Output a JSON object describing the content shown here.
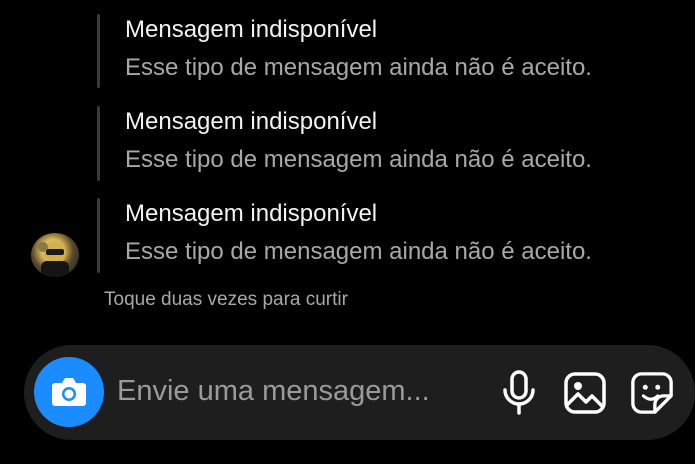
{
  "messages": [
    {
      "title": "Mensagem indisponível",
      "subtitle": "Esse tipo de mensagem ainda não é aceito."
    },
    {
      "title": "Mensagem indisponível",
      "subtitle": "Esse tipo de mensagem ainda não é aceito."
    },
    {
      "title": "Mensagem indisponível",
      "subtitle": "Esse tipo de mensagem ainda não é aceito."
    }
  ],
  "hint": "Toque duas vezes para curtir",
  "composer": {
    "placeholder": "Envie uma mensagem...",
    "camera_icon": "camera-icon",
    "mic_icon": "microphone-icon",
    "gallery_icon": "image-icon",
    "sticker_icon": "sticker-icon",
    "accent_color": "#1a8cff"
  }
}
